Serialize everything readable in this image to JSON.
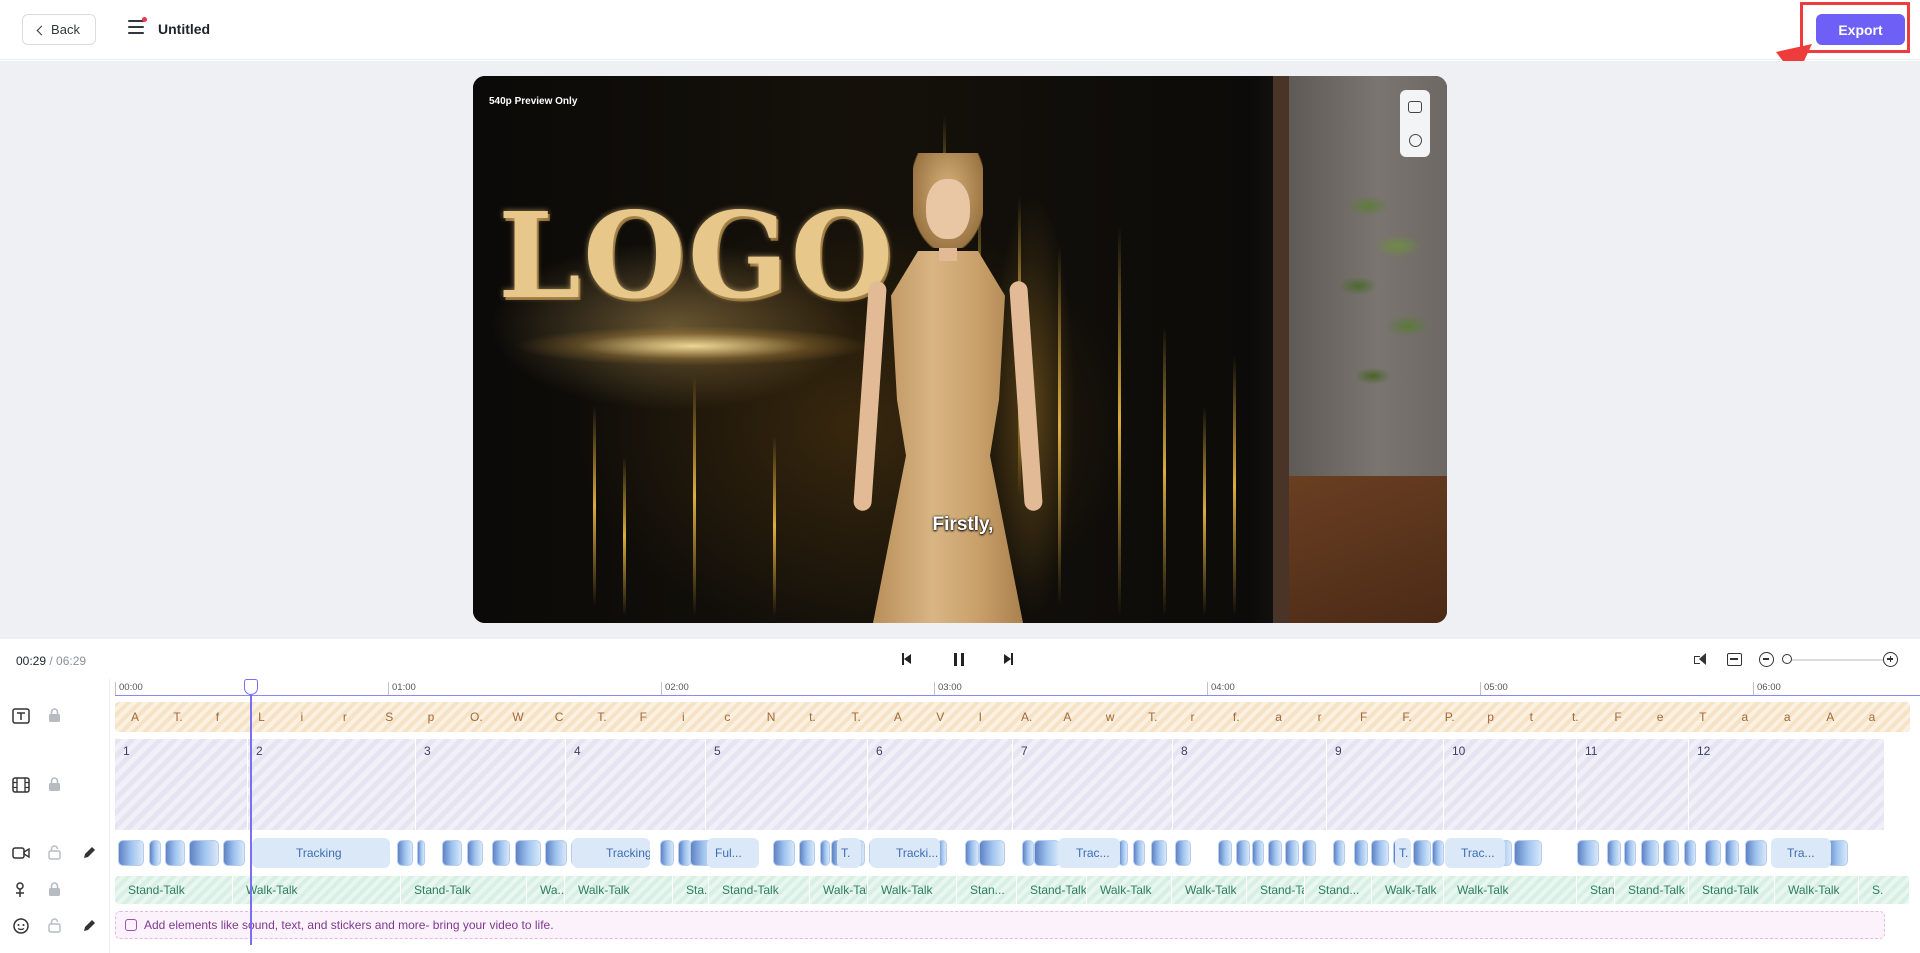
{
  "header": {
    "back_label": "Back",
    "project_title": "Untitled",
    "export_label": "Export"
  },
  "preview": {
    "quality_label": "540p Preview Only",
    "logo_text": "LOGO",
    "subtitle": "Firstly,"
  },
  "playback": {
    "current_time": "00:29",
    "separator": " / ",
    "duration": "06:29"
  },
  "timeline": {
    "ruler_ticks": [
      "00:00",
      "01:00",
      "02:00",
      "03:00",
      "04:00",
      "05:00",
      "06:00"
    ],
    "text_chars": [
      "A",
      "T.",
      "f",
      "L",
      "i",
      "r",
      "S",
      "p",
      "O.",
      "W",
      "C",
      "T.",
      "F",
      "i",
      "c",
      "N",
      "t.",
      "T.",
      "A",
      "V",
      "I",
      "A.",
      "A",
      "w",
      "T.",
      "r",
      "f.",
      "a",
      "r",
      "F",
      "F.",
      "P.",
      "p",
      "t",
      "t.",
      "F",
      "e",
      "T",
      "a",
      "a",
      "A",
      "a"
    ],
    "scenes": [
      "1",
      "2",
      "3",
      "4",
      "5",
      "6",
      "7",
      "8",
      "9",
      "10",
      "11",
      "12"
    ],
    "clip_labels": [
      "Tracking",
      "Tracking",
      "Ful...",
      "T.",
      "Tracki...",
      "Trac...",
      "T.",
      "Trac...",
      "Tra..."
    ],
    "motions": [
      "Stand-Talk",
      "Walk-Talk",
      "Stand-Talk",
      "Wa...",
      "Walk-Talk",
      "Sta...",
      "Stand-Talk",
      "Walk-Talk",
      "Walk-Talk",
      "Stan...",
      "Stand-Talk",
      "Walk-Talk",
      "Walk-Talk",
      "Stand-Talk",
      "Stand...",
      "Walk-Talk",
      "Walk-Talk",
      "Stan...",
      "Stand-Talk",
      "Stand-Talk",
      "Walk-Talk",
      "S."
    ],
    "add_elements_hint": "Add elements like sound, text, and stickers and more- bring your video to life."
  },
  "colors": {
    "accent": "#6e5ff6",
    "annotation_red": "#ee3b3b"
  }
}
